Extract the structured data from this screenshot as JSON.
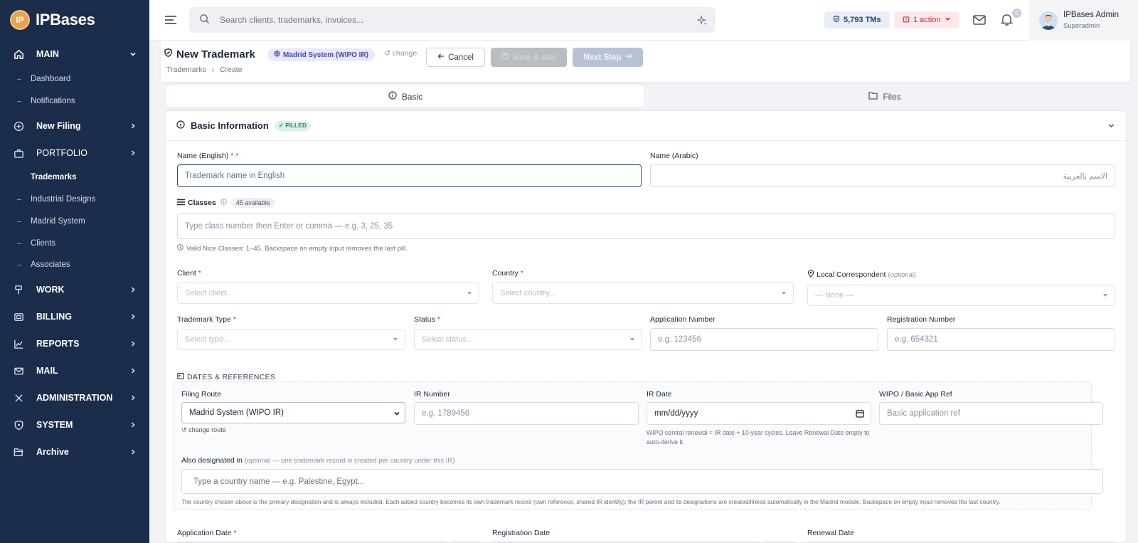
{
  "brand": {
    "logo_mark": "IP",
    "name": "IPBases"
  },
  "sidebar": {
    "main_label": "MAIN",
    "dashboard": "Dashboard",
    "notifications": "Notifications",
    "new_filing": "New Filing",
    "portfolio": "PORTFOLIO",
    "trademarks": "Trademarks",
    "industrial_designs": "Industrial Designs",
    "madrid_system": "Madrid System",
    "clients": "Clients",
    "associates": "Associates",
    "work": "WORK",
    "billing": "BILLING",
    "reports": "REPORTS",
    "mail": "MAIL",
    "administration": "ADMINISTRATION",
    "system": "SYSTEM",
    "archive": "Archive"
  },
  "topbar": {
    "search_placeholder": "Search clients, trademarks, invoices...",
    "tms_count": "5,793 TMs",
    "action_label": "1 action",
    "notif_count": "0",
    "user_name": "IPBases Admin",
    "user_role": "Superadmin"
  },
  "header": {
    "title": "New Trademark",
    "madrid_badge": "Madrid System (WIPO IR)",
    "change_label": "change",
    "cancel_label": "Cancel",
    "save_stay_label": "Save & stay",
    "next_step_label": "Next Step",
    "breadcrumb_root": "Trademarks",
    "breadcrumb_sep": "›",
    "breadcrumb_current": "Create"
  },
  "tabs": {
    "basic": "Basic",
    "files": "Files"
  },
  "section": {
    "title": "Basic Information",
    "badge": "✓ FILLED"
  },
  "form": {
    "name_en_label": "Name (English)",
    "name_en_req": "* *",
    "name_en_placeholder": "Trademark name in English",
    "name_ar_label": "Name (Arabic)",
    "name_ar_placeholder": "الاسم بالعربية",
    "classes_label": "Classes",
    "classes_avail": "45 available",
    "classes_placeholder": "Type class number then Enter or comma — e.g. 3, 25, 35",
    "classes_help": "Valid Nice Classes: 1–45. Backspace on empty input removes the last pill.",
    "client_label": "Client",
    "client_placeholder": "Select client...",
    "country_label": "Country",
    "country_placeholder": "Select country...",
    "local_corr_label": "Local Correspondent",
    "local_corr_opt": "(optional)",
    "local_corr_placeholder": "— None —",
    "tm_type_label": "Trademark Type",
    "tm_type_placeholder": "Select type...",
    "status_label": "Status",
    "status_placeholder": "Select status...",
    "app_number_label": "Application Number",
    "app_number_placeholder": "e.g. 123456",
    "reg_number_label": "Registration Number",
    "reg_number_placeholder": "e.g. 654321",
    "req_mark": "*"
  },
  "dates": {
    "section_label": "DATES & REFERENCES",
    "filing_route_label": "Filing Route",
    "filing_route_value": "Madrid System (WIPO IR)",
    "change_route": "change route",
    "ir_number_label": "IR Number",
    "ir_number_placeholder": "e.g. 1789456",
    "ir_date_label": "IR Date",
    "ir_date_placeholder": "mm/dd/yyyy",
    "ir_date_help": "WIPO central renewal = IR date + 10-year cycles. Leave Renewal Date empty to auto-derive it.",
    "wipo_ref_label": "WIPO / Basic App Ref",
    "wipo_ref_placeholder": "Basic application ref",
    "also_label": "Also designated in",
    "also_opt": "(optional — one trademark record is created per country under this IR)",
    "also_placeholder": "Type a country name — e.g. Palestine, Egypt...",
    "also_help": "The country chosen above is the primary designation and is always included. Each added country becomes its own trademark record (own reference, shared IR identity); the IR parent and its designations are created/linked automatically in the Madrid module. Backspace on empty input removes the last country.",
    "application_date_label": "Application Date",
    "registration_date_label": "Registration Date",
    "renewal_date_label": "Renewal Date"
  }
}
